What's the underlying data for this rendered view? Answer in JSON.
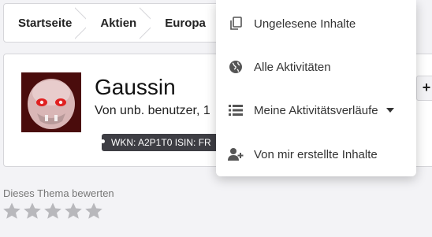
{
  "breadcrumb": {
    "items": [
      {
        "label": "Startseite"
      },
      {
        "label": "Aktien"
      },
      {
        "label": "Europa"
      }
    ]
  },
  "topic": {
    "title": "Gaussin",
    "subtitle": "Von unb. benutzer, 1",
    "tag": "WKN: A2P1T0 ISIN: FR",
    "plus_label": "+"
  },
  "rating": {
    "label": "Dieses Thema bewerten",
    "stars_total": 5,
    "stars_filled": 0
  },
  "menu": {
    "items": [
      {
        "label": "Ungelesene Inhalte",
        "icon": "copy-icon"
      },
      {
        "label": "Alle Aktivitäten",
        "icon": "globe-icon"
      },
      {
        "label": "Meine Aktivitätsverläufe",
        "icon": "list-icon"
      },
      {
        "label": "Von mir erstellte Inhalte",
        "icon": "user-plus-icon"
      }
    ]
  },
  "colors": {
    "page_bg": "#f3f3f6",
    "tag_bg": "#3e3e44",
    "star": "#b8b8bc",
    "icon": "#555555"
  }
}
